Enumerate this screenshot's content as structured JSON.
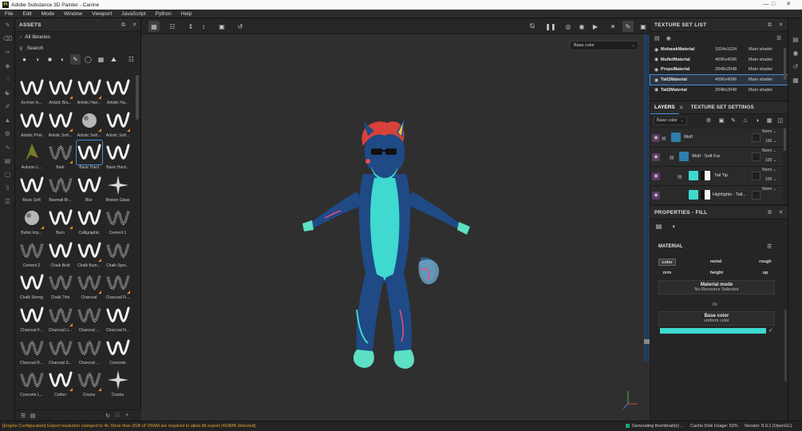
{
  "window": {
    "title": "Adobe Substance 3D Painter - Canine",
    "app_icon": "Pt",
    "controls": [
      "minimize",
      "maximize",
      "close"
    ]
  },
  "menu": [
    "File",
    "Edit",
    "Mode",
    "Window",
    "Viewport",
    "JavaScript",
    "Python",
    "Help"
  ],
  "assets": {
    "title": "ASSETS",
    "library": "All libraries",
    "search_placeholder": "Search",
    "brushes": [
      "Archive In...",
      "Artistic Bru...",
      "Artistic Hair...",
      "Artistic Ha...",
      "Artistic Print",
      "Artistic Soft...",
      "Artistic Soft...",
      "Artistic Soft...",
      "Autumn L...",
      "Bark",
      "Basic Hard",
      "Basic Hard...",
      "Basic Soft",
      "Basmati Br...",
      "Blur",
      "Broken Glass",
      "Bullet Imp...",
      "Burn",
      "Calligraphic",
      "Cement 1",
      "Cement 2",
      "Chalk Bold",
      "Chalk Bum...",
      "Chalk Spre...",
      "Chalk Strong",
      "Chalk Thin",
      "Charcoal",
      "Charcoal Fi...",
      "Charcoal F...",
      "Charcoal Li...",
      "Charcoal ...",
      "Charcoal N...",
      "Charcoal R...",
      "Charcoal S...",
      "Charcoal ...",
      "Concrete",
      "Concrete L...",
      "Cotton",
      "Cracks",
      "Cracks"
    ],
    "selected_brush": "Basic Hard"
  },
  "viewport": {
    "channel": "Base color"
  },
  "texture_set_list": {
    "title": "TEXTURE SET LIST",
    "rows": [
      {
        "name": "MohawkMaterial",
        "res": "1024x1024",
        "shader": "Main shader"
      },
      {
        "name": "MulletMaterial",
        "res": "4096x4096",
        "shader": "Main shader"
      },
      {
        "name": "PropsMaterial",
        "res": "2048x2048",
        "shader": "Main shader"
      },
      {
        "name": "Tail1Material",
        "res": "4096x4096",
        "shader": "Main shader"
      },
      {
        "name": "Tail2Material",
        "res": "2048x2048",
        "shader": "Main shader"
      }
    ],
    "selected": "Tail1Material"
  },
  "layers": {
    "tabs": [
      "LAYERS",
      "TEXTURE SET SETTINGS"
    ],
    "channel": "Base color",
    "rows": [
      {
        "name": "Wolf",
        "blend": "Norm",
        "opacity": "100"
      },
      {
        "name": "Wolf - Soft Fur",
        "blend": "Norm",
        "opacity": "100"
      },
      {
        "name": "Tail Tip",
        "blend": "Norm",
        "opacity": "100"
      },
      {
        "name": "Highlights - Tail...",
        "blend": "Norm",
        "opacity": ""
      }
    ]
  },
  "properties": {
    "title": "PROPERTIES - FILL",
    "material_label": "MATERIAL",
    "channels": [
      "color",
      "metal",
      "rough",
      "nrm",
      "height",
      "op"
    ],
    "material_mode_title": "Material mode",
    "material_mode_value": "No Resource Selected",
    "or_label": "Or",
    "base_color_title": "Base color",
    "base_color_value": "uniform color",
    "base_color_hex": "#3fd9d0"
  },
  "status": {
    "message": "[Engine Configuration] Export resolution clamped to 4k. More than 2GB of VRAM are required to allow 8k export (493MB detected).",
    "generating": "Generating thumbnail(s) ...",
    "cache": "Cache Disk Usage:   53%",
    "version": "Version: 9.0.1 (OpenGL)"
  }
}
